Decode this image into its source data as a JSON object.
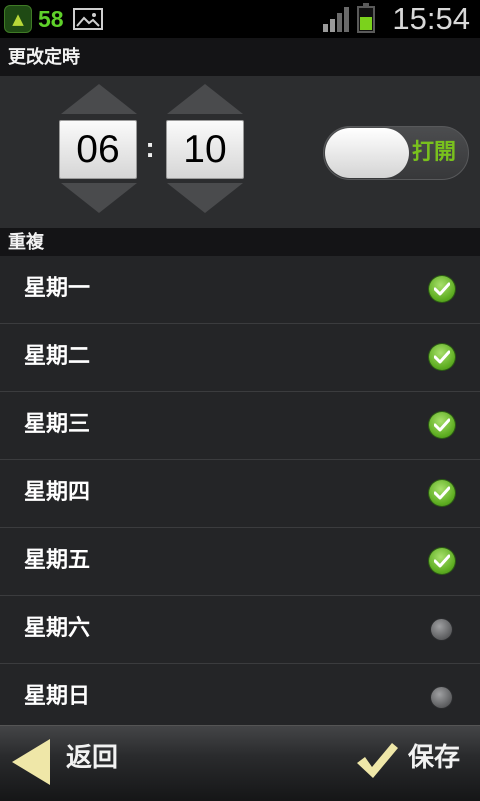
{
  "status_bar": {
    "notification_count": "58",
    "time": "15:54",
    "icons": [
      "tiger-badge-icon",
      "picture-icon",
      "signal-icon",
      "battery-icon"
    ]
  },
  "title": "更改定時",
  "time_picker": {
    "hour": "06",
    "separator": ":",
    "minute": "10"
  },
  "toggle": {
    "label": "打開",
    "state": "on"
  },
  "repeat_header": "重複",
  "days": [
    {
      "label": "星期一",
      "checked": true
    },
    {
      "label": "星期二",
      "checked": true
    },
    {
      "label": "星期三",
      "checked": true
    },
    {
      "label": "星期四",
      "checked": true
    },
    {
      "label": "星期五",
      "checked": true
    },
    {
      "label": "星期六",
      "checked": false
    },
    {
      "label": "星期日",
      "checked": false
    }
  ],
  "buttons": {
    "back": "返回",
    "save": "保存"
  },
  "colors": {
    "accent_green": "#79c11d",
    "background": "#222325",
    "header": "#141416"
  }
}
